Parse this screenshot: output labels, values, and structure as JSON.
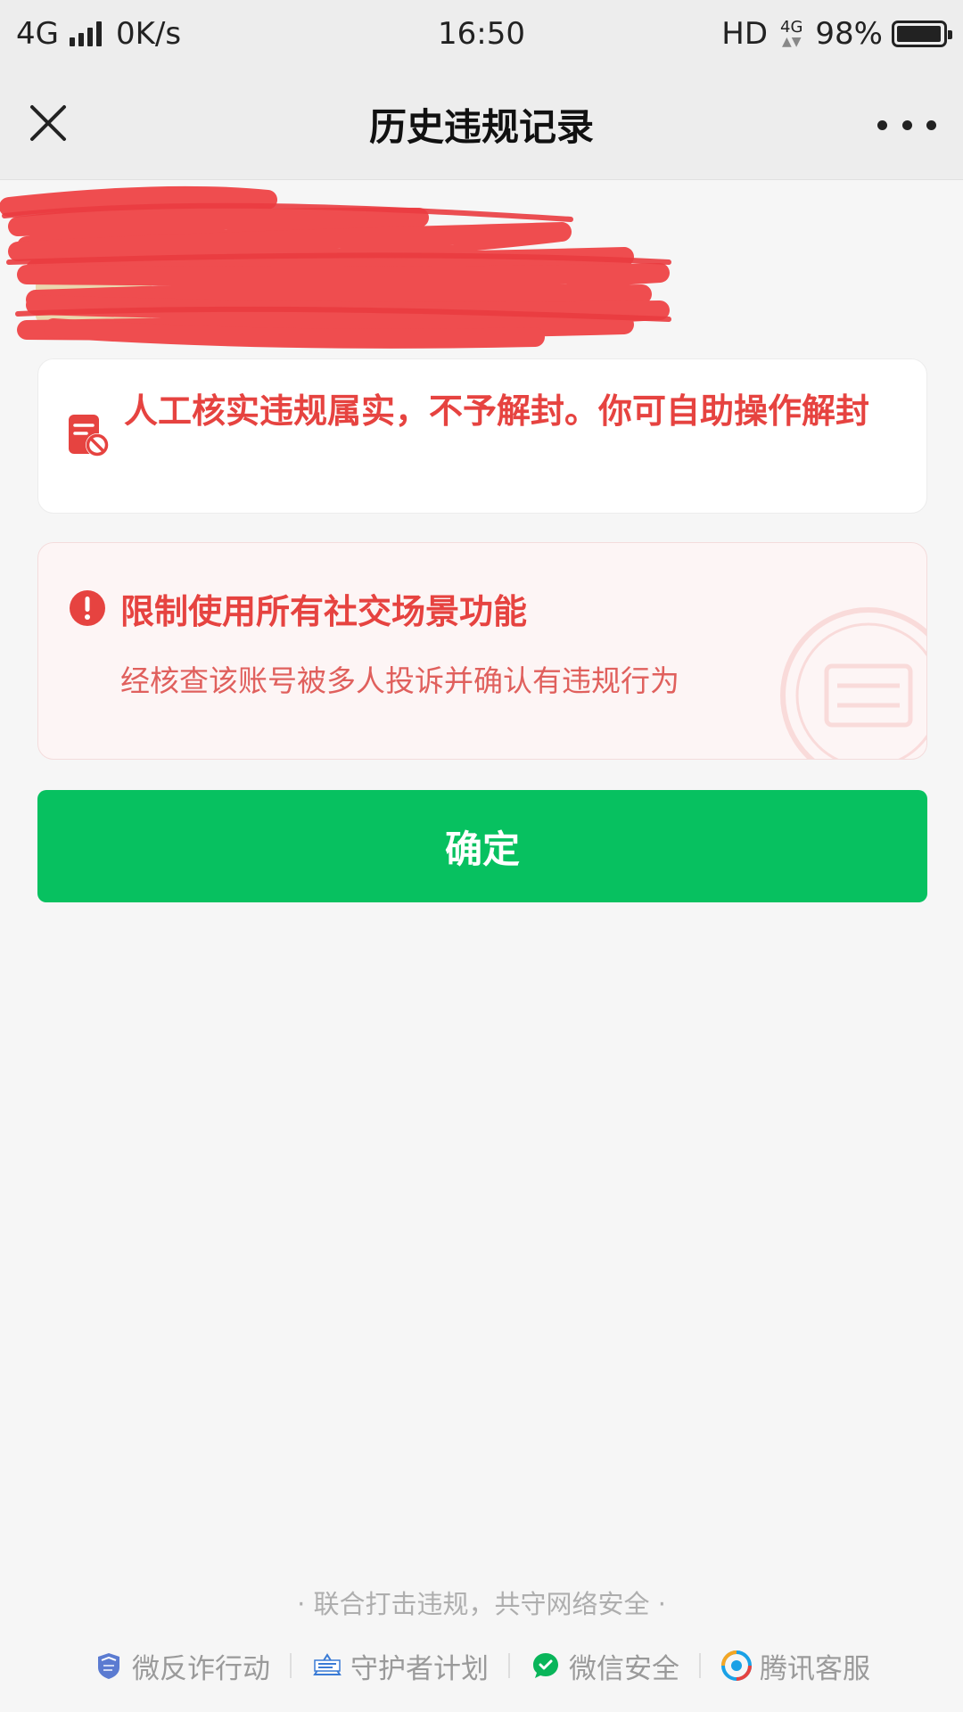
{
  "status_bar": {
    "network": "4G",
    "speed": "0K/s",
    "time": "16:50",
    "hd": "HD",
    "net_type": "4G",
    "battery": "98%",
    "battery_level": 0.98
  },
  "nav": {
    "title": "历史违规记录"
  },
  "status_card": {
    "message": "人工核实违规属实，不予解封。你可自助操作解封"
  },
  "warning_card": {
    "title": "限制使用所有社交场景功能",
    "description": "经核查该账号被多人投诉并确认有违规行为"
  },
  "confirm_button": {
    "label": "确定"
  },
  "footer": {
    "slogan": "· 联合打击违规，共守网络安全 ·",
    "links": [
      {
        "label": "微反诈行动",
        "icon": "shield-icon"
      },
      {
        "label": "守护者计划",
        "icon": "guardian-icon"
      },
      {
        "label": "微信安全",
        "icon": "wechat-security-icon"
      },
      {
        "label": "腾讯客服",
        "icon": "tencent-service-icon"
      }
    ]
  },
  "colors": {
    "accent_green": "#07c160",
    "alert_red": "#e64340",
    "redaction": "#ef4d4f"
  }
}
